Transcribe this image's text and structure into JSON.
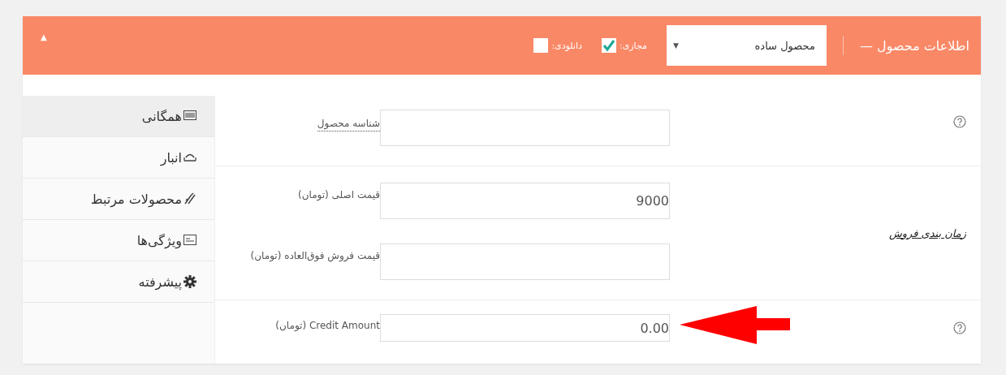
{
  "header": {
    "title": "اطلاعات محصول —",
    "product_type": {
      "value": "محصول ساده",
      "caret": "▼"
    },
    "options": [
      {
        "label": "مجازی:",
        "checked": true
      },
      {
        "label": "دانلودی:",
        "checked": false
      }
    ],
    "toggle": "▲"
  },
  "tabs": [
    {
      "label": "همگانی",
      "selected": true
    },
    {
      "label": "انبار",
      "selected": false
    },
    {
      "label": "محصولات مرتبط",
      "selected": false
    },
    {
      "label": "ویژگی‌ها",
      "selected": false
    },
    {
      "label": "پیشرفته",
      "selected": false
    }
  ],
  "sections": [
    {
      "aside": {
        "kind": "help"
      },
      "fields": [
        {
          "label": "شناسه محصول",
          "kind": "abbr"
        }
      ]
    },
    {
      "aside": {
        "kind": "link",
        "text": "زمان بندی فروش"
      },
      "fields": [
        {
          "label": "قیمت اصلی (تومان)",
          "value": "9000"
        },
        {
          "label": "قیمت فروش فوق‌العاده (تومان)"
        }
      ]
    },
    {
      "aside": {
        "kind": "help"
      },
      "fields": [
        {
          "label": "Credit Amount (تومان)",
          "value": "0.00",
          "arrow": true
        }
      ]
    }
  ]
}
